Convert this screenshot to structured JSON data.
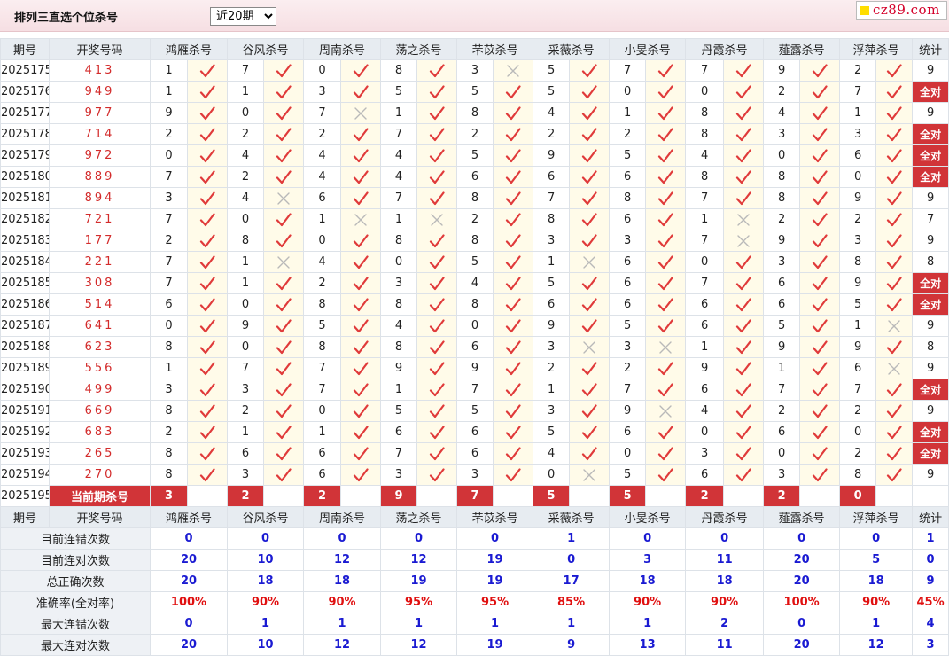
{
  "header": {
    "title": "排列三直选个位杀号",
    "period_select": "近20期",
    "logo_text": "cz89.com",
    "colors": {
      "accent": "#d13438",
      "win": "#d32b2b",
      "stat": "#1a1ad2"
    }
  },
  "columns": [
    "期号",
    "开奖号码",
    "鸿雁杀号",
    "谷风杀号",
    "周南杀号",
    "荡之杀号",
    "芣苡杀号",
    "采薇杀号",
    "小旻杀号",
    "丹霞杀号",
    "薤露杀号",
    "浮萍杀号",
    "统计"
  ],
  "rows": [
    {
      "issue": "2025175",
      "win": "413",
      "kills": [
        [
          1,
          1
        ],
        [
          7,
          1
        ],
        [
          0,
          1
        ],
        [
          8,
          1
        ],
        [
          3,
          0
        ],
        [
          5,
          1
        ],
        [
          7,
          1
        ],
        [
          7,
          1
        ],
        [
          9,
          1
        ],
        [
          2,
          1
        ]
      ],
      "stat": "9"
    },
    {
      "issue": "2025176",
      "win": "949",
      "kills": [
        [
          1,
          1
        ],
        [
          1,
          1
        ],
        [
          3,
          1
        ],
        [
          5,
          1
        ],
        [
          5,
          1
        ],
        [
          5,
          1
        ],
        [
          0,
          1
        ],
        [
          0,
          1
        ],
        [
          2,
          1
        ],
        [
          7,
          1
        ]
      ],
      "stat": "全对"
    },
    {
      "issue": "2025177",
      "win": "977",
      "kills": [
        [
          9,
          1
        ],
        [
          0,
          1
        ],
        [
          7,
          0
        ],
        [
          1,
          1
        ],
        [
          8,
          1
        ],
        [
          4,
          1
        ],
        [
          1,
          1
        ],
        [
          8,
          1
        ],
        [
          4,
          1
        ],
        [
          1,
          1
        ]
      ],
      "stat": "9"
    },
    {
      "issue": "2025178",
      "win": "714",
      "kills": [
        [
          2,
          1
        ],
        [
          2,
          1
        ],
        [
          2,
          1
        ],
        [
          7,
          1
        ],
        [
          2,
          1
        ],
        [
          2,
          1
        ],
        [
          2,
          1
        ],
        [
          8,
          1
        ],
        [
          3,
          1
        ],
        [
          3,
          1
        ]
      ],
      "stat": "全对"
    },
    {
      "issue": "2025179",
      "win": "972",
      "kills": [
        [
          0,
          1
        ],
        [
          4,
          1
        ],
        [
          4,
          1
        ],
        [
          4,
          1
        ],
        [
          5,
          1
        ],
        [
          9,
          1
        ],
        [
          5,
          1
        ],
        [
          4,
          1
        ],
        [
          0,
          1
        ],
        [
          6,
          1
        ]
      ],
      "stat": "全对"
    },
    {
      "issue": "2025180",
      "win": "889",
      "kills": [
        [
          7,
          1
        ],
        [
          2,
          1
        ],
        [
          4,
          1
        ],
        [
          4,
          1
        ],
        [
          6,
          1
        ],
        [
          6,
          1
        ],
        [
          6,
          1
        ],
        [
          8,
          1
        ],
        [
          8,
          1
        ],
        [
          0,
          1
        ]
      ],
      "stat": "全对"
    },
    {
      "issue": "2025181",
      "win": "894",
      "kills": [
        [
          3,
          1
        ],
        [
          4,
          0
        ],
        [
          6,
          1
        ],
        [
          7,
          1
        ],
        [
          8,
          1
        ],
        [
          7,
          1
        ],
        [
          8,
          1
        ],
        [
          7,
          1
        ],
        [
          8,
          1
        ],
        [
          9,
          1
        ]
      ],
      "stat": "9"
    },
    {
      "issue": "2025182",
      "win": "721",
      "kills": [
        [
          7,
          1
        ],
        [
          0,
          1
        ],
        [
          1,
          0
        ],
        [
          1,
          0
        ],
        [
          2,
          1
        ],
        [
          8,
          1
        ],
        [
          6,
          1
        ],
        [
          1,
          0
        ],
        [
          2,
          1
        ],
        [
          2,
          1
        ]
      ],
      "stat": "7"
    },
    {
      "issue": "2025183",
      "win": "177",
      "kills": [
        [
          2,
          1
        ],
        [
          8,
          1
        ],
        [
          0,
          1
        ],
        [
          8,
          1
        ],
        [
          8,
          1
        ],
        [
          3,
          1
        ],
        [
          3,
          1
        ],
        [
          7,
          0
        ],
        [
          9,
          1
        ],
        [
          3,
          1
        ]
      ],
      "stat": "9"
    },
    {
      "issue": "2025184",
      "win": "221",
      "kills": [
        [
          7,
          1
        ],
        [
          1,
          0
        ],
        [
          4,
          1
        ],
        [
          0,
          1
        ],
        [
          5,
          1
        ],
        [
          1,
          0
        ],
        [
          6,
          1
        ],
        [
          0,
          1
        ],
        [
          3,
          1
        ],
        [
          8,
          1
        ]
      ],
      "stat": "8"
    },
    {
      "issue": "2025185",
      "win": "308",
      "kills": [
        [
          7,
          1
        ],
        [
          1,
          1
        ],
        [
          2,
          1
        ],
        [
          3,
          1
        ],
        [
          4,
          1
        ],
        [
          5,
          1
        ],
        [
          6,
          1
        ],
        [
          7,
          1
        ],
        [
          6,
          1
        ],
        [
          9,
          1
        ]
      ],
      "stat": "全对"
    },
    {
      "issue": "2025186",
      "win": "514",
      "kills": [
        [
          6,
          1
        ],
        [
          0,
          1
        ],
        [
          8,
          1
        ],
        [
          8,
          1
        ],
        [
          8,
          1
        ],
        [
          6,
          1
        ],
        [
          6,
          1
        ],
        [
          6,
          1
        ],
        [
          6,
          1
        ],
        [
          5,
          1
        ]
      ],
      "stat": "全对"
    },
    {
      "issue": "2025187",
      "win": "641",
      "kills": [
        [
          0,
          1
        ],
        [
          9,
          1
        ],
        [
          5,
          1
        ],
        [
          4,
          1
        ],
        [
          0,
          1
        ],
        [
          9,
          1
        ],
        [
          5,
          1
        ],
        [
          6,
          1
        ],
        [
          5,
          1
        ],
        [
          1,
          0
        ]
      ],
      "stat": "9"
    },
    {
      "issue": "2025188",
      "win": "623",
      "kills": [
        [
          8,
          1
        ],
        [
          0,
          1
        ],
        [
          8,
          1
        ],
        [
          8,
          1
        ],
        [
          6,
          1
        ],
        [
          3,
          0
        ],
        [
          3,
          0
        ],
        [
          1,
          1
        ],
        [
          9,
          1
        ],
        [
          9,
          1
        ]
      ],
      "stat": "8"
    },
    {
      "issue": "2025189",
      "win": "556",
      "kills": [
        [
          1,
          1
        ],
        [
          7,
          1
        ],
        [
          7,
          1
        ],
        [
          9,
          1
        ],
        [
          9,
          1
        ],
        [
          2,
          1
        ],
        [
          2,
          1
        ],
        [
          9,
          1
        ],
        [
          1,
          1
        ],
        [
          6,
          0
        ]
      ],
      "stat": "9"
    },
    {
      "issue": "2025190",
      "win": "499",
      "kills": [
        [
          3,
          1
        ],
        [
          3,
          1
        ],
        [
          7,
          1
        ],
        [
          1,
          1
        ],
        [
          7,
          1
        ],
        [
          1,
          1
        ],
        [
          7,
          1
        ],
        [
          6,
          1
        ],
        [
          7,
          1
        ],
        [
          7,
          1
        ]
      ],
      "stat": "全对"
    },
    {
      "issue": "2025191",
      "win": "669",
      "kills": [
        [
          8,
          1
        ],
        [
          2,
          1
        ],
        [
          0,
          1
        ],
        [
          5,
          1
        ],
        [
          5,
          1
        ],
        [
          3,
          1
        ],
        [
          9,
          0
        ],
        [
          4,
          1
        ],
        [
          2,
          1
        ],
        [
          2,
          1
        ]
      ],
      "stat": "9"
    },
    {
      "issue": "2025192",
      "win": "683",
      "kills": [
        [
          2,
          1
        ],
        [
          1,
          1
        ],
        [
          1,
          1
        ],
        [
          6,
          1
        ],
        [
          6,
          1
        ],
        [
          5,
          1
        ],
        [
          6,
          1
        ],
        [
          0,
          1
        ],
        [
          6,
          1
        ],
        [
          0,
          1
        ]
      ],
      "stat": "全对"
    },
    {
      "issue": "2025193",
      "win": "265",
      "kills": [
        [
          8,
          1
        ],
        [
          6,
          1
        ],
        [
          6,
          1
        ],
        [
          7,
          1
        ],
        [
          6,
          1
        ],
        [
          4,
          1
        ],
        [
          0,
          1
        ],
        [
          3,
          1
        ],
        [
          0,
          1
        ],
        [
          2,
          1
        ]
      ],
      "stat": "全对"
    },
    {
      "issue": "2025194",
      "win": "270",
      "kills": [
        [
          8,
          1
        ],
        [
          3,
          1
        ],
        [
          6,
          1
        ],
        [
          3,
          1
        ],
        [
          3,
          1
        ],
        [
          0,
          0
        ],
        [
          5,
          1
        ],
        [
          6,
          1
        ],
        [
          3,
          1
        ],
        [
          8,
          1
        ]
      ],
      "stat": "9"
    }
  ],
  "current": {
    "issue": "2025195",
    "label": "当前期杀号",
    "kills": [
      "3",
      "2",
      "2",
      "9",
      "7",
      "5",
      "5",
      "2",
      "2",
      "0"
    ]
  },
  "stats": [
    {
      "label": "目前连错次数",
      "values": [
        "0",
        "0",
        "0",
        "0",
        "0",
        "1",
        "0",
        "0",
        "0",
        "0",
        "1"
      ],
      "red": false
    },
    {
      "label": "目前连对次数",
      "values": [
        "20",
        "10",
        "12",
        "12",
        "19",
        "0",
        "3",
        "11",
        "20",
        "5",
        "0"
      ],
      "red": false
    },
    {
      "label": "总正确次数",
      "values": [
        "20",
        "18",
        "18",
        "19",
        "19",
        "17",
        "18",
        "18",
        "20",
        "18",
        "9"
      ],
      "red": false
    },
    {
      "label": "准确率(全对率)",
      "values": [
        "100%",
        "90%",
        "90%",
        "95%",
        "95%",
        "85%",
        "90%",
        "90%",
        "100%",
        "90%",
        "45%"
      ],
      "red": true
    },
    {
      "label": "最大连错次数",
      "values": [
        "0",
        "1",
        "1",
        "1",
        "1",
        "1",
        "1",
        "2",
        "0",
        "1",
        "4"
      ],
      "red": false
    },
    {
      "label": "最大连对次数",
      "values": [
        "20",
        "10",
        "12",
        "12",
        "19",
        "9",
        "13",
        "11",
        "20",
        "12",
        "3"
      ],
      "red": false
    }
  ]
}
